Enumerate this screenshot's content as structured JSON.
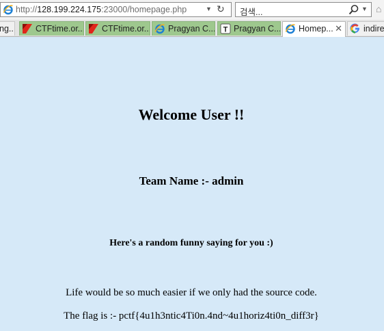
{
  "address_bar": {
    "url_scheme": "http://",
    "url_host": "128.199.224.175",
    "url_rest": ":23000/homepage.php",
    "search_placeholder": "검색..."
  },
  "tabs": [
    {
      "label": "ng...",
      "icon": "page-icon"
    },
    {
      "label": "CTFtime.or...",
      "icon": "ctftime-flag-icon"
    },
    {
      "label": "CTFtime.or...",
      "icon": "ctftime-flag-icon"
    },
    {
      "label": "Pragyan C...",
      "icon": "ie-icon"
    },
    {
      "label": "Pragyan C...",
      "icon": "t-icon"
    },
    {
      "label": "Homep...",
      "icon": "ie-icon",
      "active": true,
      "close": "✕"
    },
    {
      "label": "indire",
      "icon": "google-icon"
    }
  ],
  "page": {
    "welcome": "Welcome User !!",
    "team": "Team Name :- admin",
    "saying_heading": "Here's a random funny saying for you :)",
    "saying": "Life would be so much easier if we only had the source code.",
    "flag": "The flag is :- pctf{4u1h3ntic4Ti0n.4nd~4u1horiz4ti0n_diff3r}"
  },
  "colors": {
    "page_background": "#d6e9f8",
    "tab_inactive": "#9ec88e",
    "tab_active": "#ffffff"
  }
}
